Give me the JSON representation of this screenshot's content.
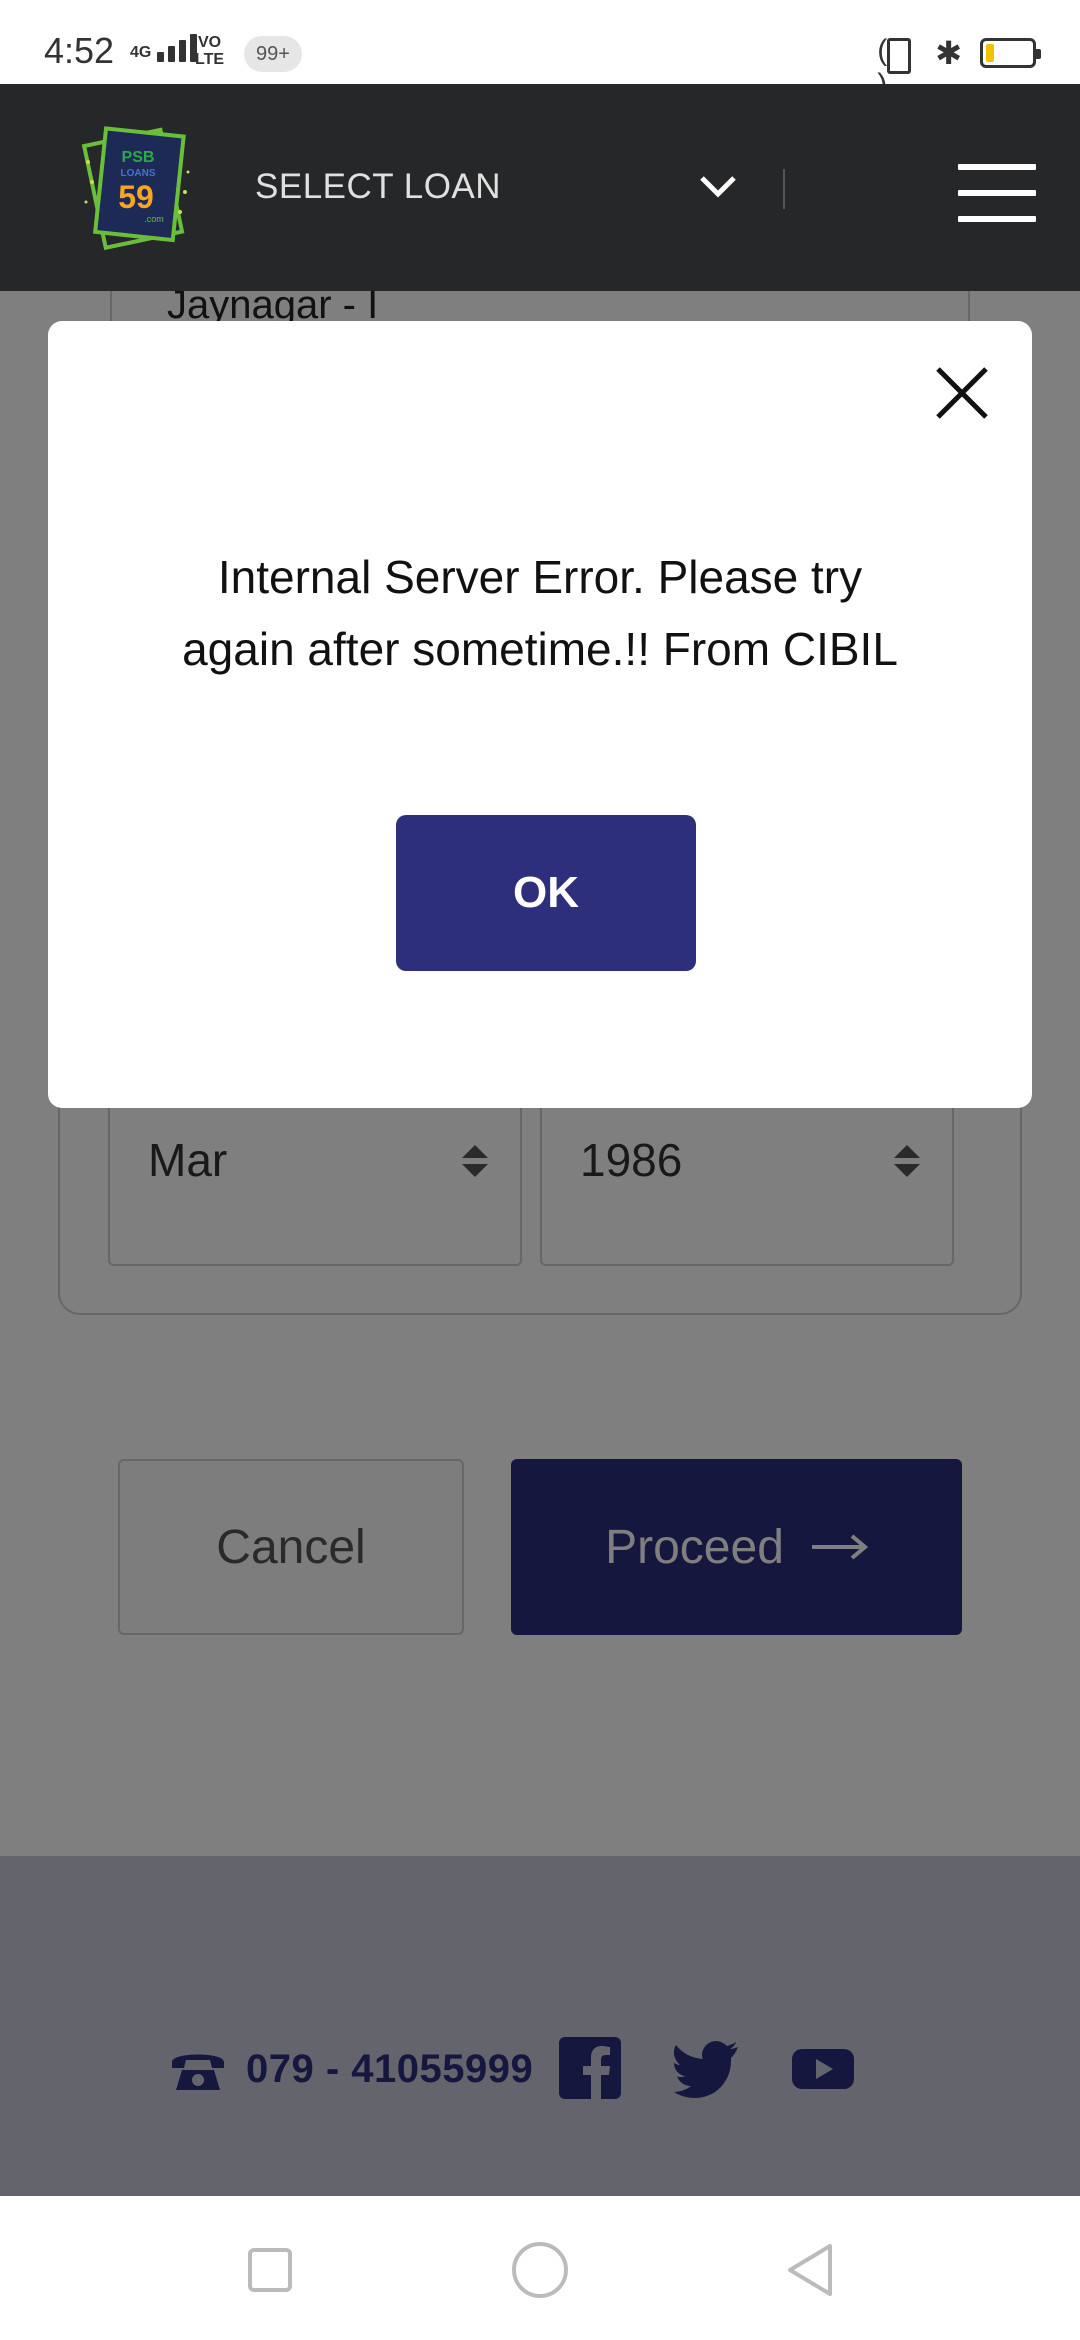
{
  "status_bar": {
    "time": "4:52",
    "network": "4G",
    "volte_line1": "VO",
    "volte_line2": "LTE",
    "notification_badge": "99+",
    "battery_color": "#f2c200"
  },
  "header": {
    "logo_text_top": "PSB",
    "logo_text_mid": "LOANS",
    "logo_number": "59",
    "logo_suffix": ".com",
    "select_loan_label": "SELECT LOAN",
    "menu_icon": "hamburger-icon",
    "dropdown_icon": "chevron-down-icon"
  },
  "form": {
    "partial_field_value": "Jaynagar - I",
    "month_value": "Mar",
    "year_value": "1986",
    "cancel_label": "Cancel",
    "proceed_label": "Proceed"
  },
  "footer": {
    "phone": "079 - 41055999",
    "social_icons": [
      "facebook-icon",
      "twitter-icon",
      "youtube-icon"
    ]
  },
  "modal": {
    "message": "Internal Server Error. Please try again after sometime.!! From CIBIL",
    "ok_label": "OK",
    "close_icon": "close-icon"
  },
  "colors": {
    "header_bg": "#262729",
    "primary": "#2d2f7d",
    "footer_bg": "#c9c9d9"
  }
}
